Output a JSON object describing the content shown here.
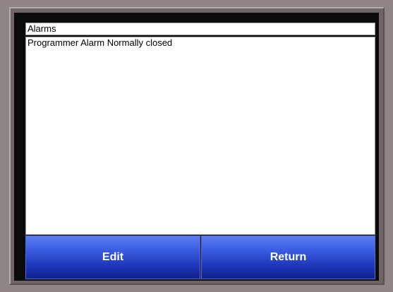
{
  "header": {
    "title": "Alarms"
  },
  "alarms": {
    "items": [
      {
        "label": "Programmer Alarm Normally closed"
      }
    ]
  },
  "buttons": {
    "edit_label": "Edit",
    "return_label": "Return"
  },
  "colors": {
    "bezel": "#8f8587",
    "screen_background": "#0b0b0b",
    "button_blue": "#2a45cc",
    "button_text": "#ffffff"
  }
}
